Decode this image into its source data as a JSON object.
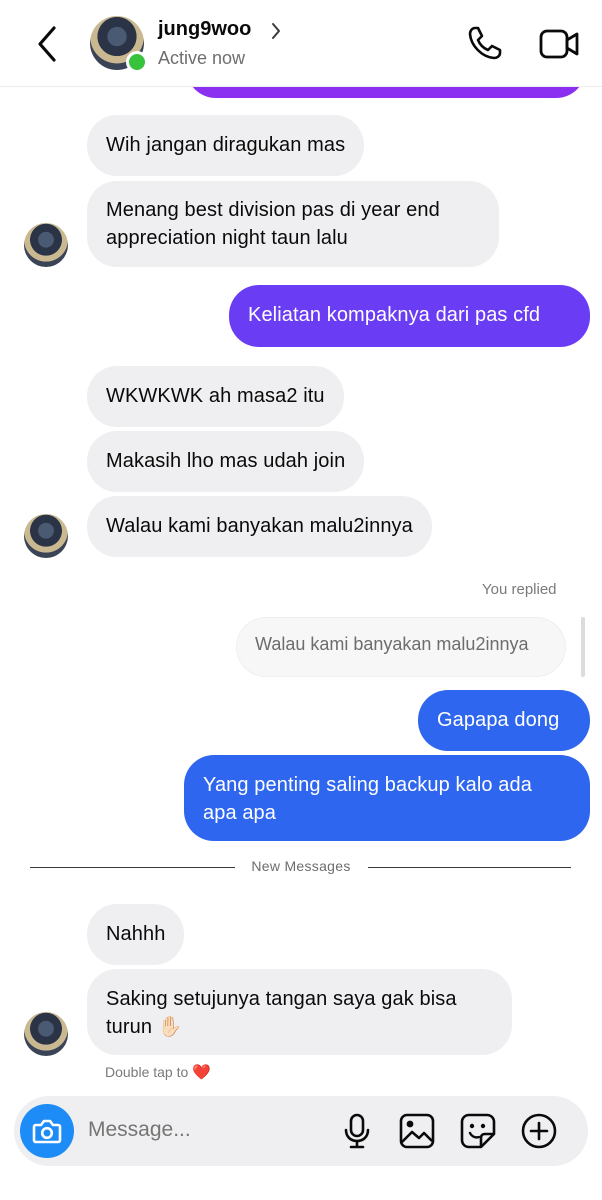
{
  "header": {
    "username": "jung9woo",
    "status": "Active now"
  },
  "messages": {
    "m1": "Wih jangan diragukan mas",
    "m2": "Menang best division pas di year end appreciation night taun lalu",
    "m3": "Keliatan kompaknya dari pas cfd",
    "m4": "WKWKWK ah masa2 itu",
    "m5": "Makasih lho mas udah join",
    "m6": "Walau kami banyakan malu2innya",
    "you_replied": "You replied",
    "reply_quote": "Walau kami banyakan malu2innya",
    "m7": "Gapapa dong",
    "m8": "Yang penting saling backup kalo ada apa apa",
    "new_messages": "New Messages",
    "m9": "Nahhh",
    "m10": "Saking setujunya tangan saya gak bisa turun",
    "m10_emoji": "✋🏻",
    "double_tap": "Double tap to",
    "double_tap_icon": "❤️"
  },
  "composer": {
    "placeholder": "Message..."
  },
  "colors": {
    "sent_purple": "#6a3df5",
    "sent_blue": "#2f66ef",
    "received": "#efeff1",
    "online": "#37c33b",
    "camera": "#1d8cf6"
  },
  "icons": [
    "back-arrow-icon",
    "chevron-right-icon",
    "phone-icon",
    "video-camera-icon",
    "camera-icon",
    "microphone-icon",
    "image-icon",
    "sticker-icon",
    "plus-circle-icon"
  ]
}
